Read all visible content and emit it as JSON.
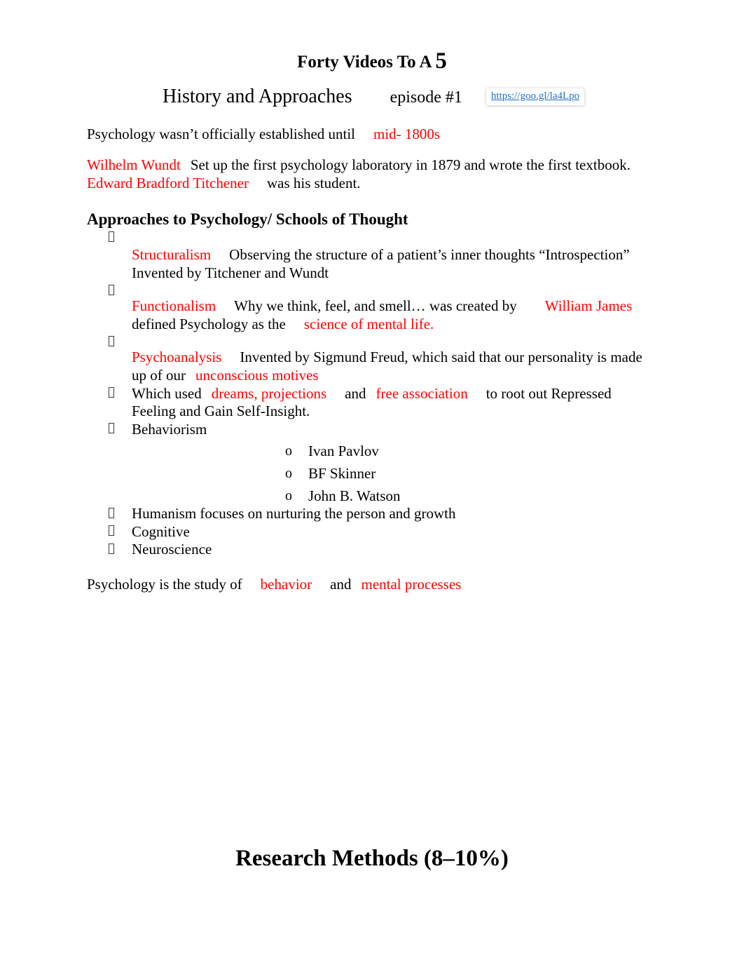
{
  "document": {
    "title_prefix": "Forty Videos To A ",
    "title_grade": "5",
    "subtitle_main": "History and Approaches",
    "subtitle_episode": "episode #1",
    "link_text": "https://goo.gl/la4Lpo",
    "link_color": "#1F6FC4",
    "highlight_color": "#FF0000",
    "body_color": "#000000"
  },
  "paragraphs": {
    "established": {
      "lead": "Psychology wasn’t officially established until",
      "highlight": "mid- 1800s"
    },
    "wundt": {
      "name": "Wilhelm Wundt",
      "body": "Set up the first psychology laboratory in 1879 and wrote the first textbook.",
      "student_name": "Edward Bradford Titchener",
      "tail": "was his student."
    },
    "definition": {
      "lead": "Psychology is the study of",
      "highlight_1": "behavior",
      "conjunction": "and",
      "highlight_2": "mental processes"
    }
  },
  "section": {
    "heading": "Approaches to Psychology/ Schools of Thought"
  },
  "bullets": {
    "structuralism": {
      "term": "Structuralism",
      "definition": "Observing the structure of a patient’s inner thoughts",
      "line2": "“Introspection” Invented by Titchener and Wundt"
    },
    "functionalism": {
      "term": "Functionalism",
      "definition": "Why we think, feel, and smell… was created by",
      "person": "William James",
      "line2_lead": "defined Psychology as the",
      "line2_highlight": "science of mental life."
    },
    "psychoanalysis": {
      "term": "Psychoanalysis",
      "definition": "Invented by Sigmund Freud, which said that our personality is made up of our",
      "highlight": "unconscious motives"
    },
    "methods": {
      "lead": "Which used",
      "highlight_1": "dreams, projections",
      "conjunction": "and",
      "highlight_2": "free association",
      "tail": "to root out Repressed Feeling and Gain Self-Insight."
    },
    "behaviorism": {
      "term": "Behaviorism",
      "people": [
        "Ivan Pavlov",
        "BF Skinner",
        "John B. Watson"
      ]
    },
    "humanism": {
      "term": "Humanism focuses on nurturing the person and growth"
    },
    "cognitive": {
      "term": "Cognitive"
    },
    "neuroscience": {
      "term": "Neuroscience"
    }
  },
  "bottom": {
    "heading": "Research Methods (8–10%)"
  }
}
